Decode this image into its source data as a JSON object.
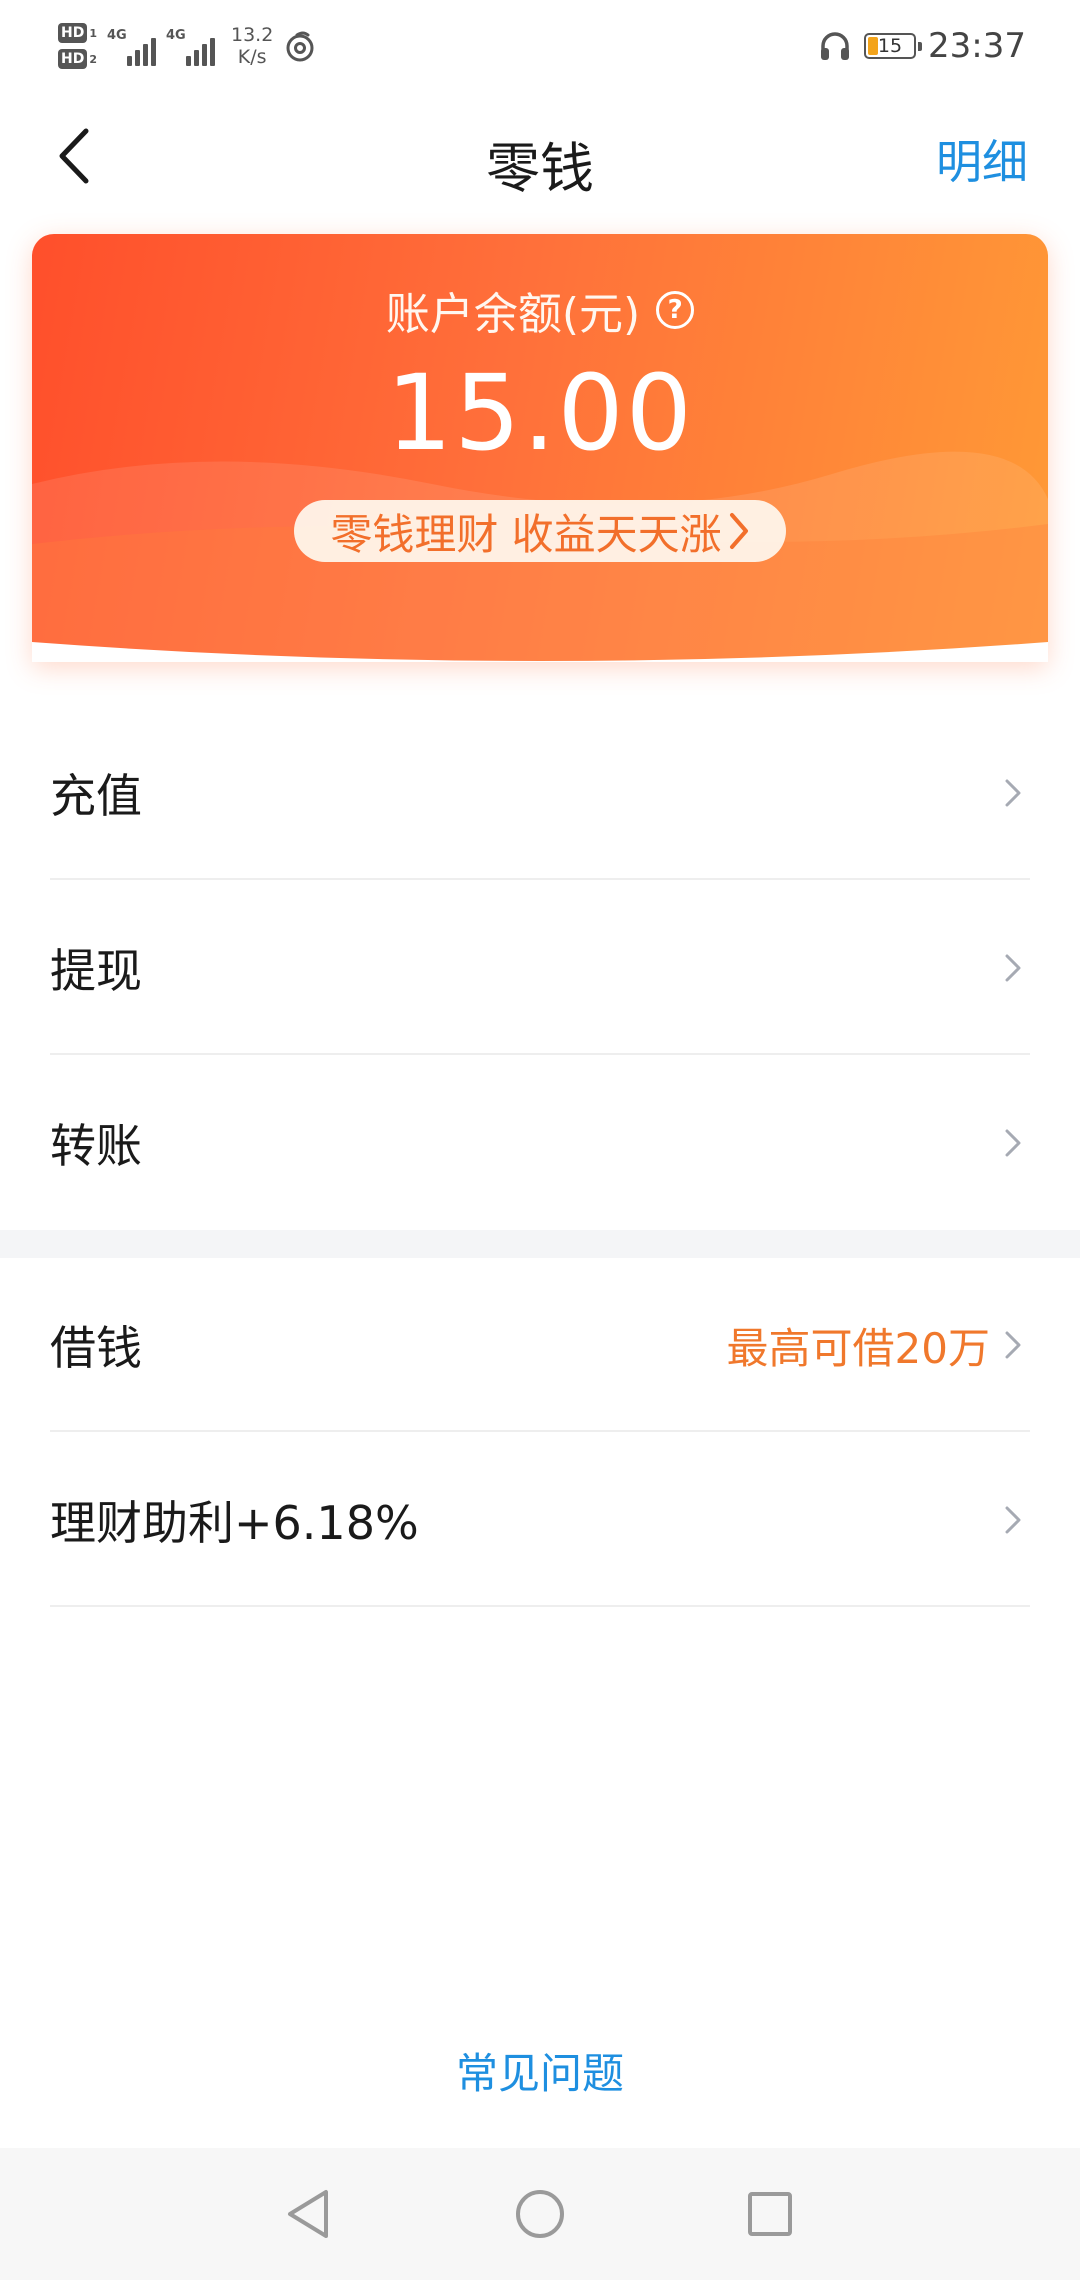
{
  "status_bar": {
    "hd1": "HD",
    "hd1_num": "1",
    "hd2": "HD",
    "hd2_num": "2",
    "sim1_tech": "4G",
    "sim2_tech": "4G",
    "speed_value": "13.2",
    "speed_unit": "K/s",
    "battery_level": "15",
    "time": "23:37"
  },
  "header": {
    "title": "零钱",
    "detail_link": "明细"
  },
  "balance_card": {
    "label": "账户余额(元)",
    "help_symbol": "?",
    "amount": "15.00",
    "promo": "零钱理财 收益天天涨"
  },
  "menu_group_1": [
    {
      "label": "充值"
    },
    {
      "label": "提现"
    },
    {
      "label": "转账"
    }
  ],
  "menu_group_2": [
    {
      "label": "借钱",
      "note": "最高可借20万"
    },
    {
      "label": "理财助利+6.18%"
    }
  ],
  "footer": {
    "faq": "常见问题"
  },
  "colors": {
    "accent_blue": "#1e8fe0",
    "accent_orange": "#f0782c",
    "card_gradient_start": "#ff4f2b",
    "card_gradient_end": "#ff9a36"
  }
}
